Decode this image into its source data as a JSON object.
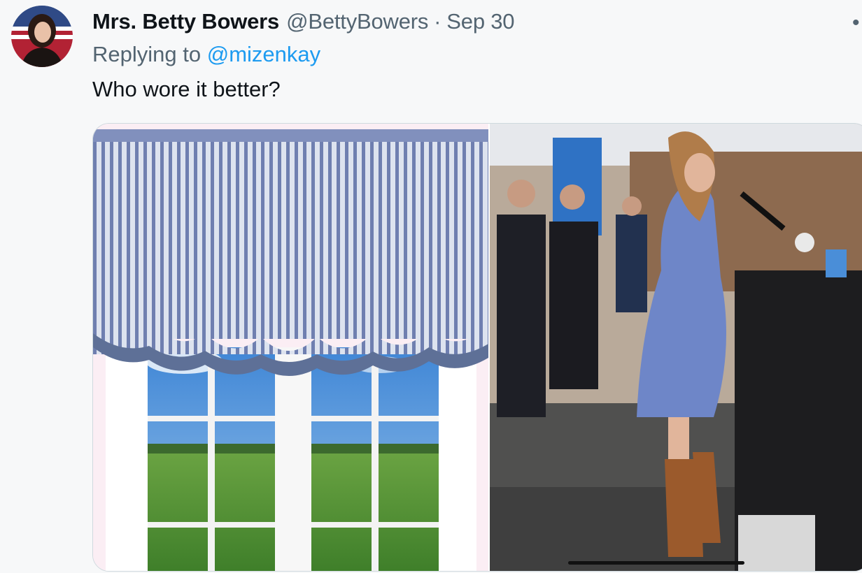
{
  "tweet": {
    "author_name": "Mrs. Betty Bowers",
    "author_handle": "@BettyBowers",
    "separator": "·",
    "date": "Sep 30",
    "replying_prefix": "Replying to",
    "replying_to": "@mizenkay",
    "text": "Who wore it better?",
    "more_icon": "more-options-icon"
  },
  "media": {
    "left_image": "striped-valance-curtain-over-window-with-field-view",
    "right_image": "woman-in-striped-dress-at-podium-press-conference"
  }
}
